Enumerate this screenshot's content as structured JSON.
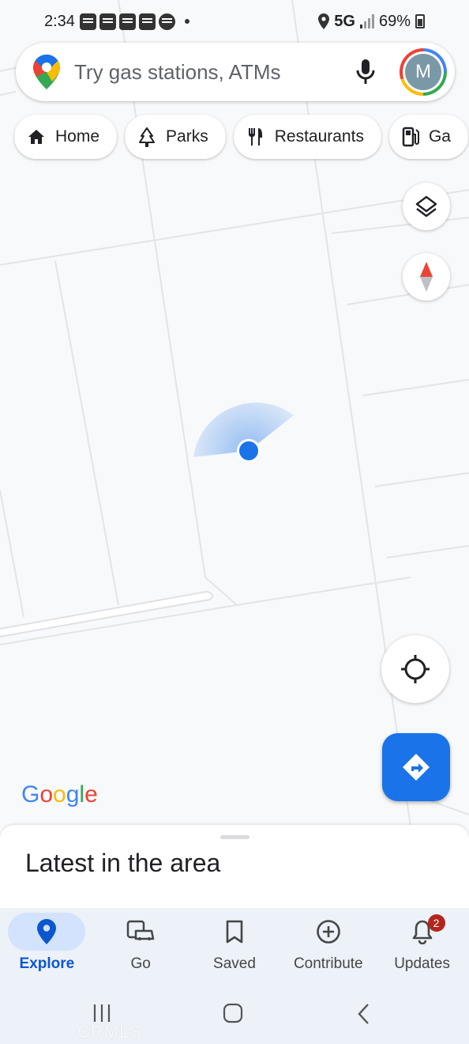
{
  "status_bar": {
    "time": "2:34",
    "network": "5G",
    "battery": "69%"
  },
  "search": {
    "placeholder": "Try gas stations, ATMs",
    "avatar_initial": "M"
  },
  "chips": [
    {
      "label": "Home",
      "icon": "home-icon"
    },
    {
      "label": "Parks",
      "icon": "tree-icon"
    },
    {
      "label": "Restaurants",
      "icon": "fork-knife-icon"
    },
    {
      "label": "Ga",
      "icon": "gas-pump-icon"
    }
  ],
  "map": {
    "logo": "Google",
    "logo_colors": [
      "#4285f4",
      "#ea4335",
      "#fbbc05",
      "#4285f4",
      "#34a853",
      "#ea4335"
    ],
    "location_dot_color": "#1a73e8"
  },
  "sheet": {
    "title": "Latest in the area"
  },
  "bottom_nav": {
    "items": [
      {
        "label": "Explore",
        "icon": "location-pin-icon",
        "active": true
      },
      {
        "label": "Go",
        "icon": "commute-icon"
      },
      {
        "label": "Saved",
        "icon": "bookmark-icon"
      },
      {
        "label": "Contribute",
        "icon": "add-circle-icon"
      },
      {
        "label": "Updates",
        "icon": "bell-icon",
        "badge": "2"
      }
    ]
  },
  "watermark": "CRMLS",
  "colors": {
    "accent": "#1a73e8",
    "nav_active_bg": "#d3e3fd",
    "badge": "#b3261e"
  }
}
